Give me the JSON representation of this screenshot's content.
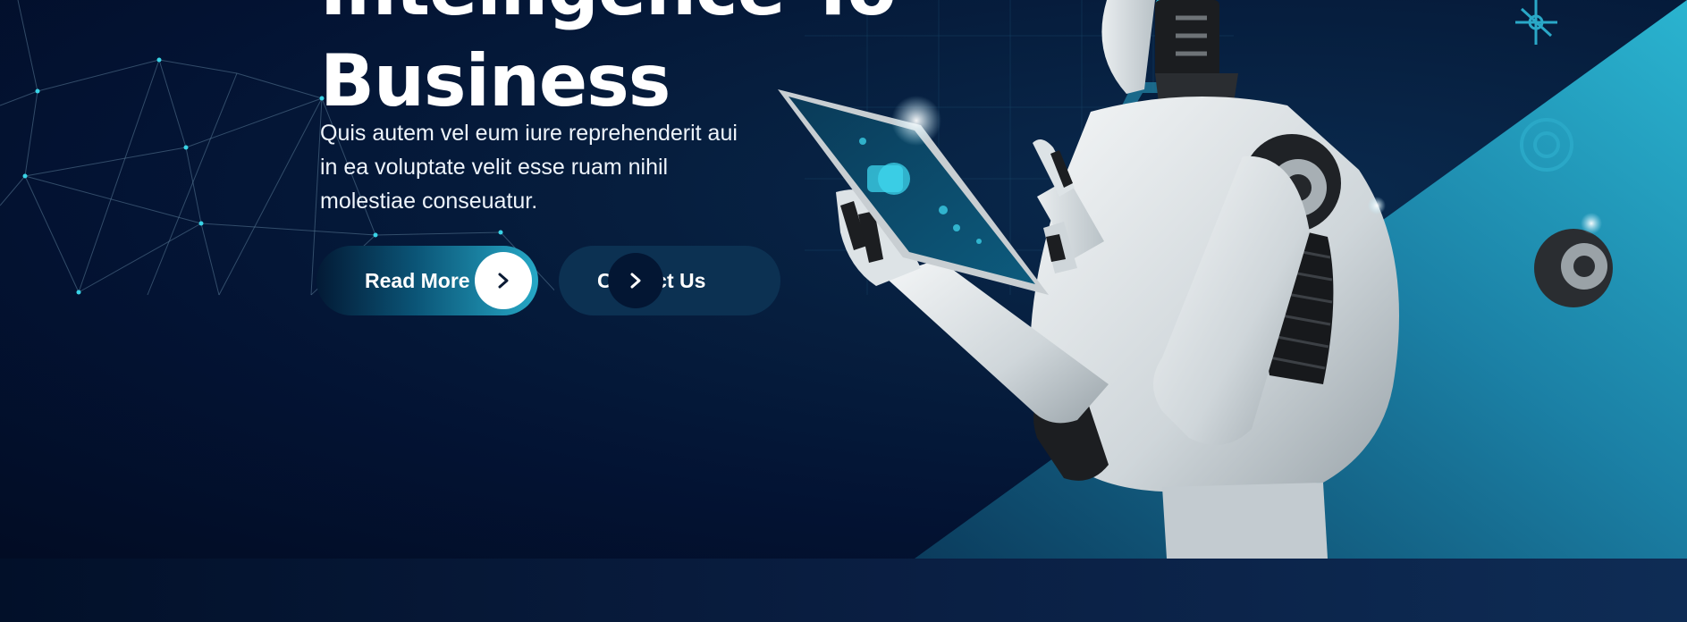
{
  "hero": {
    "title_line1": "Intelligence To",
    "title_line2": "Business",
    "description": "Quis autem vel eum iure reprehenderit aui in ea voluptate velit esse ruam nihil molestiae conseuatur."
  },
  "buttons": {
    "read_more": {
      "label": "Read More",
      "icon": "chevron-right-icon"
    },
    "contact_us": {
      "label": "Contact Us",
      "icon": "chevron-right-icon"
    }
  },
  "colors": {
    "background": "#03132e",
    "accent": "#26a8c6",
    "text": "#ffffff"
  }
}
